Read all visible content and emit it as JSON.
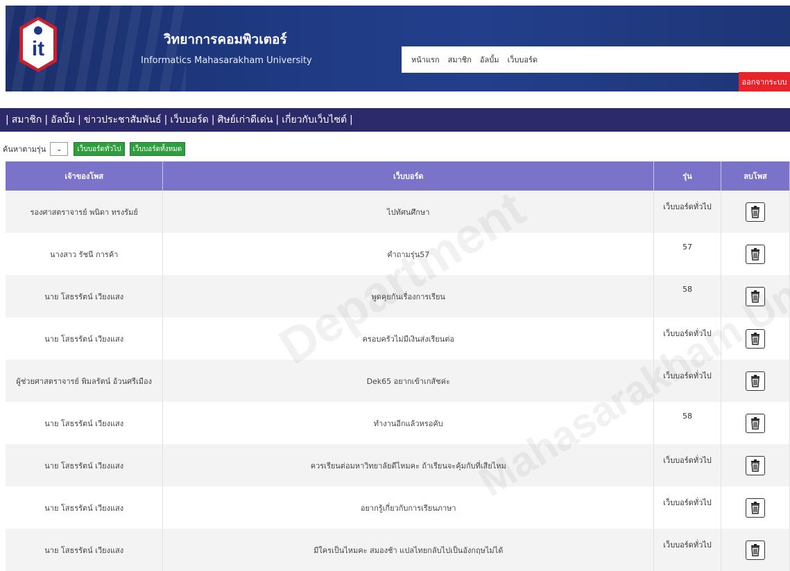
{
  "header": {
    "title": "วิทยาการคอมพิวเตอร์",
    "subtitle": "Informatics Mahasarakham University",
    "logo_text": "it",
    "nav": [
      "หน้าแรก",
      "สมาชิก",
      "อัลบั้ม",
      "เว็บบอร์ด"
    ],
    "logout_label": "ออกจากระบบ"
  },
  "menu": [
    "สมาชิก",
    "อัลบั้ม",
    "ข่าวประชาสัมพันธ์",
    "เว็บบอร์ด",
    "ศิษย์เก่าดีเด่น",
    "เกี่ยวกับเว็บไซต์"
  ],
  "filter": {
    "label": "ค้นหาตามรุ่น",
    "select_icon": "chevron-down-icon",
    "btn_general": "เว็บบอร์ดทั่วไป",
    "btn_all": "เว็บบอร์ดทั้งหมด"
  },
  "table": {
    "headers": [
      "เจ้าของโพส",
      "เว็บบอร์ด",
      "รุ่น",
      "ลบโพส"
    ],
    "rows": [
      {
        "owner": "รองศาสตราจารย์ พนิดา ทรงรัมย์",
        "topic": "ไปทัศนศึกษา",
        "gen": "เว็บบอร์ดทั่วไป"
      },
      {
        "owner": "นางสาว รัชนี การค้า",
        "topic": "คำถามรุ่น57",
        "gen": "57"
      },
      {
        "owner": "นาย โสธรรัตน์ เวียงแสง",
        "topic": "พูดคุยกันเรื่องการเรียน",
        "gen": "58"
      },
      {
        "owner": "นาย โสธรรัตน์ เวียงแสง",
        "topic": "ครอบครัวไม่มีเงินส่งเรียนต่อ",
        "gen": "เว็บบอร์ดทั่วไป"
      },
      {
        "owner": "ผู้ช่วยศาสตราจารย์ พิมลรัตน์ อ้วนศรีเมือง",
        "topic": "Dek65 อยากเข้าเกสัชค่ะ",
        "gen": "เว็บบอร์ดทั่วไป"
      },
      {
        "owner": "นาย โสธรรัตน์ เวียงแสง",
        "topic": "ทำงานอีกแล้วหรอคับ",
        "gen": "58"
      },
      {
        "owner": "นาย โสธรรัตน์ เวียงแสง",
        "topic": "ควรเรียนต่อมหาวิทยาลัยดีไหมคะ ถ้าเรียนจะคุ้มกับที่เสียไหม",
        "gen": "เว็บบอร์ดทั่วไป"
      },
      {
        "owner": "นาย โสธรรัตน์ เวียงแสง",
        "topic": "อยากรู้เกี่ยวกับการเรียนภาษา",
        "gen": "เว็บบอร์ดทั่วไป"
      },
      {
        "owner": "นาย โสธรรัตน์ เวียงแสง",
        "topic": "มีใครเป็นไหมคะ สมองช้า แปลไทยกลับไปเป็นอังกฤษไม่ได้",
        "gen": "เว็บบอร์ดทั่วไป"
      }
    ],
    "delete_icon": "trash-icon"
  },
  "watermark": [
    "Department",
    "Mahasarakham University"
  ],
  "colors": {
    "header_bg": "#1f3a82",
    "menubar_bg": "#2d2a6b",
    "table_header_bg": "#7b73c9",
    "logout_bg": "#e8232a",
    "button_green": "#2e9e3e"
  }
}
